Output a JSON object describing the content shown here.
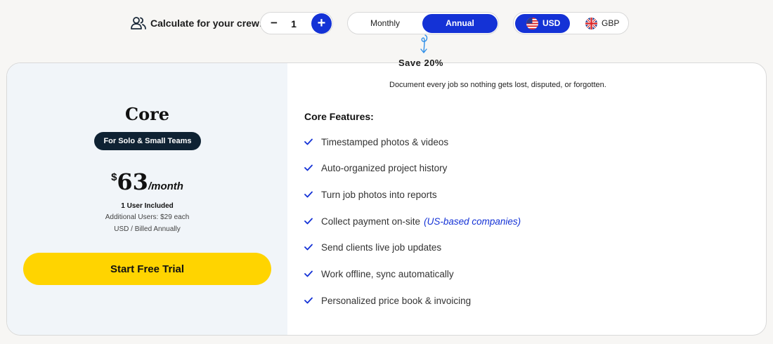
{
  "crew": {
    "label": "Calculate for your crew:",
    "minus_label": "−",
    "plus_label": "+",
    "quantity": "1"
  },
  "billing": {
    "options": [
      "Monthly",
      "Annual"
    ],
    "selected": "Annual",
    "savings_label": "Save 20%"
  },
  "currency": {
    "options": [
      "USD",
      "GBP"
    ],
    "selected": "USD"
  },
  "plan": {
    "name": "Core",
    "badge": "For Solo & Small Teams",
    "currency_symbol": "$",
    "price": "63",
    "period": "/month",
    "users_included": "1 User Included",
    "additional_users": "Additional Users: $29 each",
    "billing_note": "USD / Billed Annually",
    "cta_label": "Start Free Trial"
  },
  "features": {
    "description": "Document every job so nothing gets lost, disputed, or forgotten.",
    "title": "Core Features:",
    "items": [
      {
        "text": "Timestamped photos & videos",
        "note": ""
      },
      {
        "text": "Auto-organized project history",
        "note": ""
      },
      {
        "text": "Turn job photos into reports",
        "note": ""
      },
      {
        "text": "Collect payment on-site",
        "note": "(US-based companies)"
      },
      {
        "text": "Send clients live job updates",
        "note": ""
      },
      {
        "text": "Work offline, sync automatically",
        "note": ""
      },
      {
        "text": "Personalized price book & invoicing",
        "note": ""
      }
    ]
  },
  "icons": {
    "crew": "users-icon",
    "check": "check-icon",
    "usd_flag": "us-flag-icon",
    "gbp_flag": "uk-flag-icon",
    "arrow": "curly-arrow-icon"
  },
  "colors": {
    "accent_blue": "#1432d6",
    "cta_yellow": "#ffd400",
    "badge_dark": "#0f2233",
    "plan_panel_bg": "#f1f5f9"
  }
}
